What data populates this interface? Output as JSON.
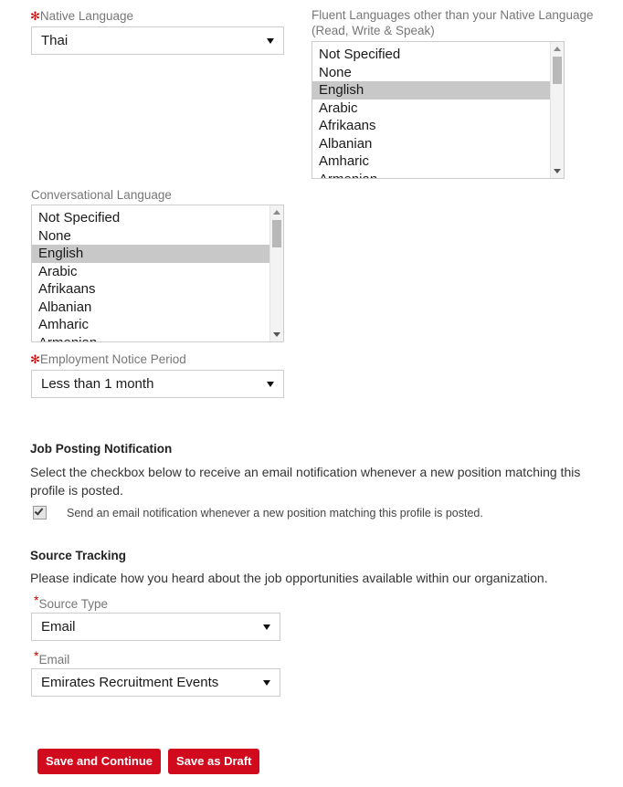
{
  "native_language": {
    "label": "Native Language",
    "required": true,
    "value": "Thai"
  },
  "fluent_languages": {
    "label": "Fluent Languages other than your Native Language (Read, Write & Speak)",
    "required": false,
    "options": [
      "Not Specified",
      "None",
      "English",
      "Arabic",
      "Afrikaans",
      "Albanian",
      "Amharic",
      "Armenian"
    ],
    "selected": "English"
  },
  "conversational_language": {
    "label": "Conversational Language",
    "required": false,
    "options": [
      "Not Specified",
      "None",
      "English",
      "Arabic",
      "Afrikaans",
      "Albanian",
      "Amharic",
      "Armenian"
    ],
    "selected": "English"
  },
  "employment_notice_period": {
    "label": "Employment Notice Period",
    "required": true,
    "value": "Less than 1 month"
  },
  "job_posting_notification": {
    "title": "Job Posting Notification",
    "description": "Select the checkbox below to receive an email notification whenever a new position matching this profile is posted.",
    "checkbox_label": "Send an email notification whenever a new position matching this profile is posted.",
    "checked": true
  },
  "source_tracking": {
    "title": "Source Tracking",
    "description": "Please indicate how you heard about the job opportunities available within our organization.",
    "source_type": {
      "label": "Source Type",
      "required": true,
      "value": "Email"
    },
    "email": {
      "label": "Email",
      "required": true,
      "value": "Emirates Recruitment Events"
    }
  },
  "actions": {
    "save_and_continue": "Save and Continue",
    "save_as_draft": "Save as Draft"
  },
  "colors": {
    "required_asterisk": "#cc0000",
    "button_red": "#d10a1e",
    "label_grey": "#777777",
    "selection_grey": "#c8c8c8"
  }
}
